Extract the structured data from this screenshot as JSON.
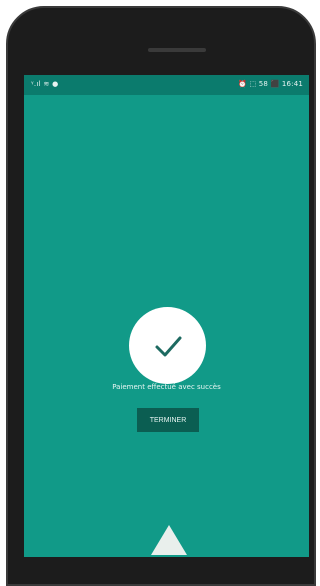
{
  "statusbar": {
    "left_text": "ᵞ.ıl ≋ ●",
    "right_text": "⏰ ⬚ 58 ⬛ 16:41"
  },
  "screen": {
    "background_color": "#119a88",
    "statusbar_color": "#0b7b6d",
    "check_icon": "checkmark-icon",
    "message": "Paiement effectué avec succès",
    "button_label": "TERMINER",
    "button_color": "#0b5e52"
  }
}
